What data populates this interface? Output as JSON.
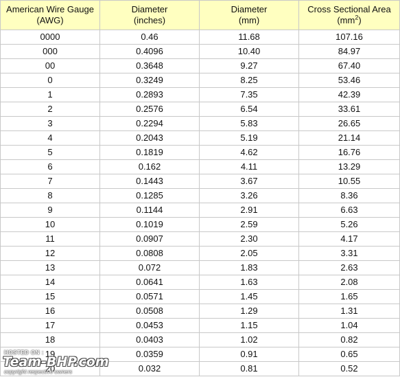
{
  "table": {
    "headers": [
      {
        "line1": "American Wire Gauge",
        "line2": "(AWG)",
        "sup": ""
      },
      {
        "line1": "Diameter",
        "line2": "(inches)",
        "sup": ""
      },
      {
        "line1": "Diameter",
        "line2": "(mm)",
        "sup": ""
      },
      {
        "line1": "Cross Sectional Area",
        "line2": "(mm",
        "sup": "2",
        "line2_end": ")"
      }
    ],
    "rows": [
      [
        "0000",
        "0.46",
        "11.68",
        "107.16"
      ],
      [
        "000",
        "0.4096",
        "10.40",
        "84.97"
      ],
      [
        "00",
        "0.3648",
        "9.27",
        "67.40"
      ],
      [
        "0",
        "0.3249",
        "8.25",
        "53.46"
      ],
      [
        "1",
        "0.2893",
        "7.35",
        "42.39"
      ],
      [
        "2",
        "0.2576",
        "6.54",
        "33.61"
      ],
      [
        "3",
        "0.2294",
        "5.83",
        "26.65"
      ],
      [
        "4",
        "0.2043",
        "5.19",
        "21.14"
      ],
      [
        "5",
        "0.1819",
        "4.62",
        "16.76"
      ],
      [
        "6",
        "0.162",
        "4.11",
        "13.29"
      ],
      [
        "7",
        "0.1443",
        "3.67",
        "10.55"
      ],
      [
        "8",
        "0.1285",
        "3.26",
        "8.36"
      ],
      [
        "9",
        "0.1144",
        "2.91",
        "6.63"
      ],
      [
        "10",
        "0.1019",
        "2.59",
        "5.26"
      ],
      [
        "11",
        "0.0907",
        "2.30",
        "4.17"
      ],
      [
        "12",
        "0.0808",
        "2.05",
        "3.31"
      ],
      [
        "13",
        "0.072",
        "1.83",
        "2.63"
      ],
      [
        "14",
        "0.0641",
        "1.63",
        "2.08"
      ],
      [
        "15",
        "0.0571",
        "1.45",
        "1.65"
      ],
      [
        "16",
        "0.0508",
        "1.29",
        "1.31"
      ],
      [
        "17",
        "0.0453",
        "1.15",
        "1.04"
      ],
      [
        "18",
        "0.0403",
        "1.02",
        "0.82"
      ],
      [
        "19",
        "0.0359",
        "0.91",
        "0.65"
      ],
      [
        "20",
        "0.032",
        "0.81",
        "0.52"
      ]
    ]
  },
  "watermark": {
    "hosted_on": "HOSTED ON :",
    "logo": "Team-BHP.com",
    "copyright": "copyright respective owners"
  },
  "colors": {
    "header_background": "#ffffc0",
    "border": "#c8c8c8"
  }
}
